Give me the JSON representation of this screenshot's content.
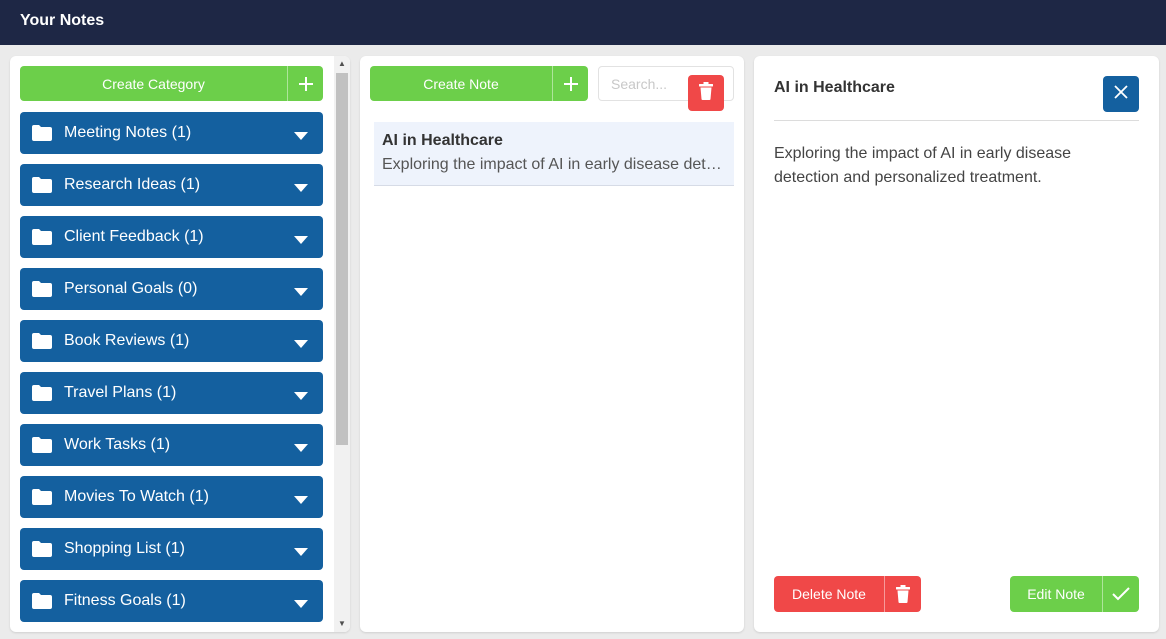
{
  "header": {
    "title": "Your Notes"
  },
  "sidebar": {
    "create_category_label": "Create Category",
    "categories": [
      {
        "label": "Meeting Notes (1)"
      },
      {
        "label": "Research Ideas (1)"
      },
      {
        "label": "Client Feedback (1)"
      },
      {
        "label": "Personal Goals (0)"
      },
      {
        "label": "Book Reviews (1)"
      },
      {
        "label": "Travel Plans (1)"
      },
      {
        "label": "Work Tasks (1)"
      },
      {
        "label": "Movies To Watch (1)"
      },
      {
        "label": "Shopping List (1)"
      },
      {
        "label": "Fitness Goals (1)"
      }
    ]
  },
  "notes": {
    "create_note_label": "Create Note",
    "search_placeholder": "Search...",
    "items": [
      {
        "title": "AI in Healthcare",
        "snippet": "Exploring the impact of AI in early disease detection and personalized treatment."
      }
    ]
  },
  "detail": {
    "title": "AI in Healthcare",
    "body": "Exploring the impact of AI in early disease detection and personalized treatment.",
    "delete_label": "Delete Note",
    "edit_label": "Edit Note"
  },
  "colors": {
    "topbar": "#1e2745",
    "category_blue": "#14609f",
    "green": "#6ccf4a",
    "red": "#f04848",
    "note_selected_bg": "#eef3fc"
  },
  "icons": {
    "folder": "folder-icon",
    "chevron": "chevron-down-icon",
    "plus": "plus-icon",
    "trash": "trash-icon",
    "close": "close-icon",
    "check": "check-icon"
  }
}
